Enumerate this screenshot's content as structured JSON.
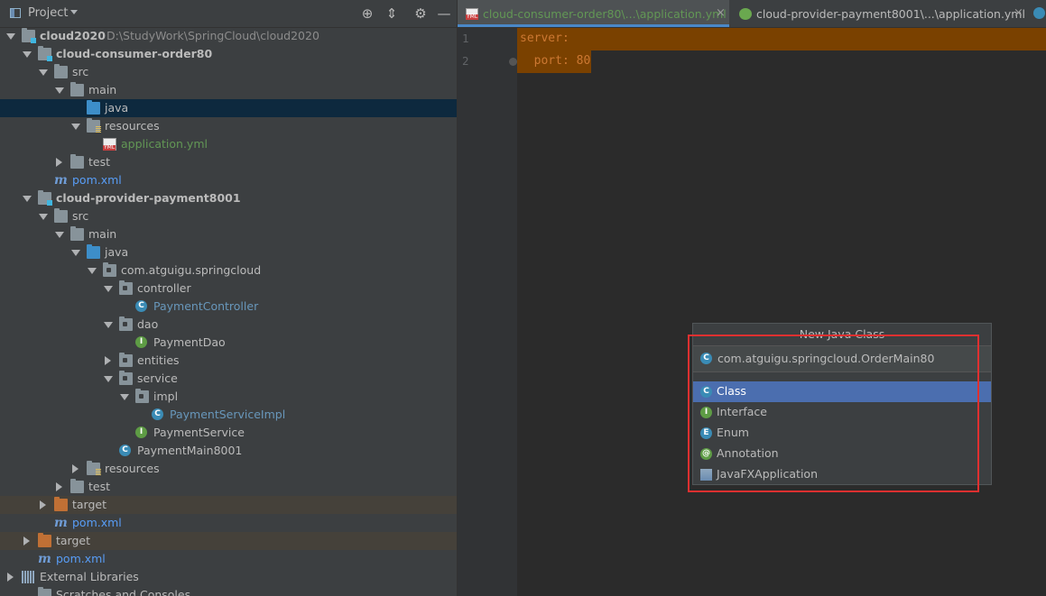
{
  "project_panel": {
    "title": "Project",
    "tree": [
      {
        "label": "cloud2020",
        "sub": "D:\\StudyWork\\SpringCloud\\cloud2020",
        "icon": "module-folder-icon",
        "state": "expanded"
      },
      {
        "label": "cloud-consumer-order80",
        "icon": "module-folder-icon",
        "state": "expanded"
      },
      {
        "label": "src",
        "icon": "folder-icon",
        "state": "expanded"
      },
      {
        "label": "main",
        "icon": "folder-icon",
        "state": "expanded"
      },
      {
        "label": "java",
        "icon": "source-folder-icon",
        "state": "selected"
      },
      {
        "label": "resources",
        "icon": "resources-folder-icon",
        "state": "expanded"
      },
      {
        "label": "application.yml",
        "icon": "yml-file-icon"
      },
      {
        "label": "test",
        "icon": "folder-icon",
        "state": "collapsed"
      },
      {
        "label": "pom.xml",
        "icon": "maven-icon"
      },
      {
        "label": "cloud-provider-payment8001",
        "icon": "module-folder-icon",
        "state": "expanded"
      },
      {
        "label": "src",
        "icon": "folder-icon",
        "state": "expanded"
      },
      {
        "label": "main",
        "icon": "folder-icon",
        "state": "expanded"
      },
      {
        "label": "java",
        "icon": "source-folder-icon",
        "state": "expanded"
      },
      {
        "label": "com.atguigu.springcloud",
        "icon": "package-icon",
        "state": "expanded"
      },
      {
        "label": "controller",
        "icon": "package-icon",
        "state": "expanded"
      },
      {
        "label": "PaymentController",
        "icon": "class-icon"
      },
      {
        "label": "dao",
        "icon": "package-icon",
        "state": "expanded"
      },
      {
        "label": "PaymentDao",
        "icon": "interface-icon"
      },
      {
        "label": "entities",
        "icon": "package-icon",
        "state": "collapsed"
      },
      {
        "label": "service",
        "icon": "package-icon",
        "state": "expanded"
      },
      {
        "label": "impl",
        "icon": "package-icon",
        "state": "expanded"
      },
      {
        "label": "PaymentServiceImpl",
        "icon": "class-icon"
      },
      {
        "label": "PaymentService",
        "icon": "interface-icon"
      },
      {
        "label": "PaymentMain8001",
        "icon": "spring-boot-class-icon"
      },
      {
        "label": "resources",
        "icon": "resources-folder-icon",
        "state": "collapsed"
      },
      {
        "label": "test",
        "icon": "folder-icon",
        "state": "collapsed"
      },
      {
        "label": "target",
        "icon": "excluded-folder-icon",
        "state": "collapsed"
      },
      {
        "label": "pom.xml",
        "icon": "maven-icon"
      },
      {
        "label": "target",
        "icon": "excluded-folder-icon",
        "state": "collapsed"
      },
      {
        "label": "pom.xml",
        "icon": "maven-icon"
      },
      {
        "label": "External Libraries",
        "icon": "libraries-icon",
        "state": "collapsed"
      },
      {
        "label": "Scratches and Consoles",
        "icon": "scratches-icon"
      }
    ]
  },
  "editor": {
    "tabs": [
      {
        "label": "cloud-consumer-order80\\...\\application.yml",
        "icon": "yml-file-icon",
        "active": true
      },
      {
        "label": "cloud-provider-payment8001\\...\\application.yml",
        "icon": "spring-yml-icon",
        "active": false
      }
    ],
    "lines": [
      {
        "number": "1",
        "text": "server:"
      },
      {
        "number": "2",
        "text": "  port: 80"
      }
    ]
  },
  "new_class_popup": {
    "title": "New Java Class",
    "name_value": "com.atguigu.springcloud.OrderMain80",
    "kinds": [
      {
        "label": "Class",
        "icon": "class-icon",
        "glyph": "C",
        "selected": true
      },
      {
        "label": "Interface",
        "icon": "interface-icon",
        "glyph": "I",
        "selected": false
      },
      {
        "label": "Enum",
        "icon": "enum-icon",
        "glyph": "E",
        "selected": false
      },
      {
        "label": "Annotation",
        "icon": "annotation-icon",
        "glyph": "@",
        "selected": false
      },
      {
        "label": "JavaFXApplication",
        "icon": "javafx-icon",
        "glyph": "",
        "selected": false
      }
    ]
  },
  "colors": {
    "selection": "#4b6eaf",
    "highlight": "#7a4100",
    "annotation_box": "#e03030"
  }
}
